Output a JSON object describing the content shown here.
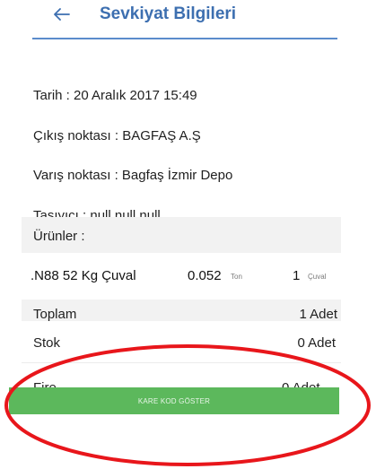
{
  "header": {
    "title": "Sevkiyat Bilgileri",
    "back_icon": "arrow-left-icon",
    "title_color": "#3d6fb0",
    "underline_color": "#5b8ccc"
  },
  "info": {
    "date": "Tarih : 20 Aralık 2017 15:49",
    "origin": "Çıkış noktası : BAGFAŞ A.Ş",
    "destination": "Varış noktası : Bagfaş İzmir Depo",
    "carrier": "Taşıyıcı : null null null"
  },
  "products": {
    "label": "Ürünler :",
    "items": [
      {
        "name": ".N88 52 Kg Çuval",
        "weight": "0.052",
        "weight_unit": "Ton",
        "quantity": "1",
        "quantity_unit": "Çuval"
      }
    ],
    "total_label": "Toplam",
    "total_value": "1 Adet"
  },
  "stock": {
    "label": "Stok",
    "value": "0 Adet"
  },
  "partial_row": {
    "label": "Fire",
    "value": "0 Adet"
  },
  "qr_button": {
    "label": "KARE KOD GÖSTER",
    "color": "#5cb85c"
  },
  "annotation": {
    "color": "#e8161b"
  }
}
